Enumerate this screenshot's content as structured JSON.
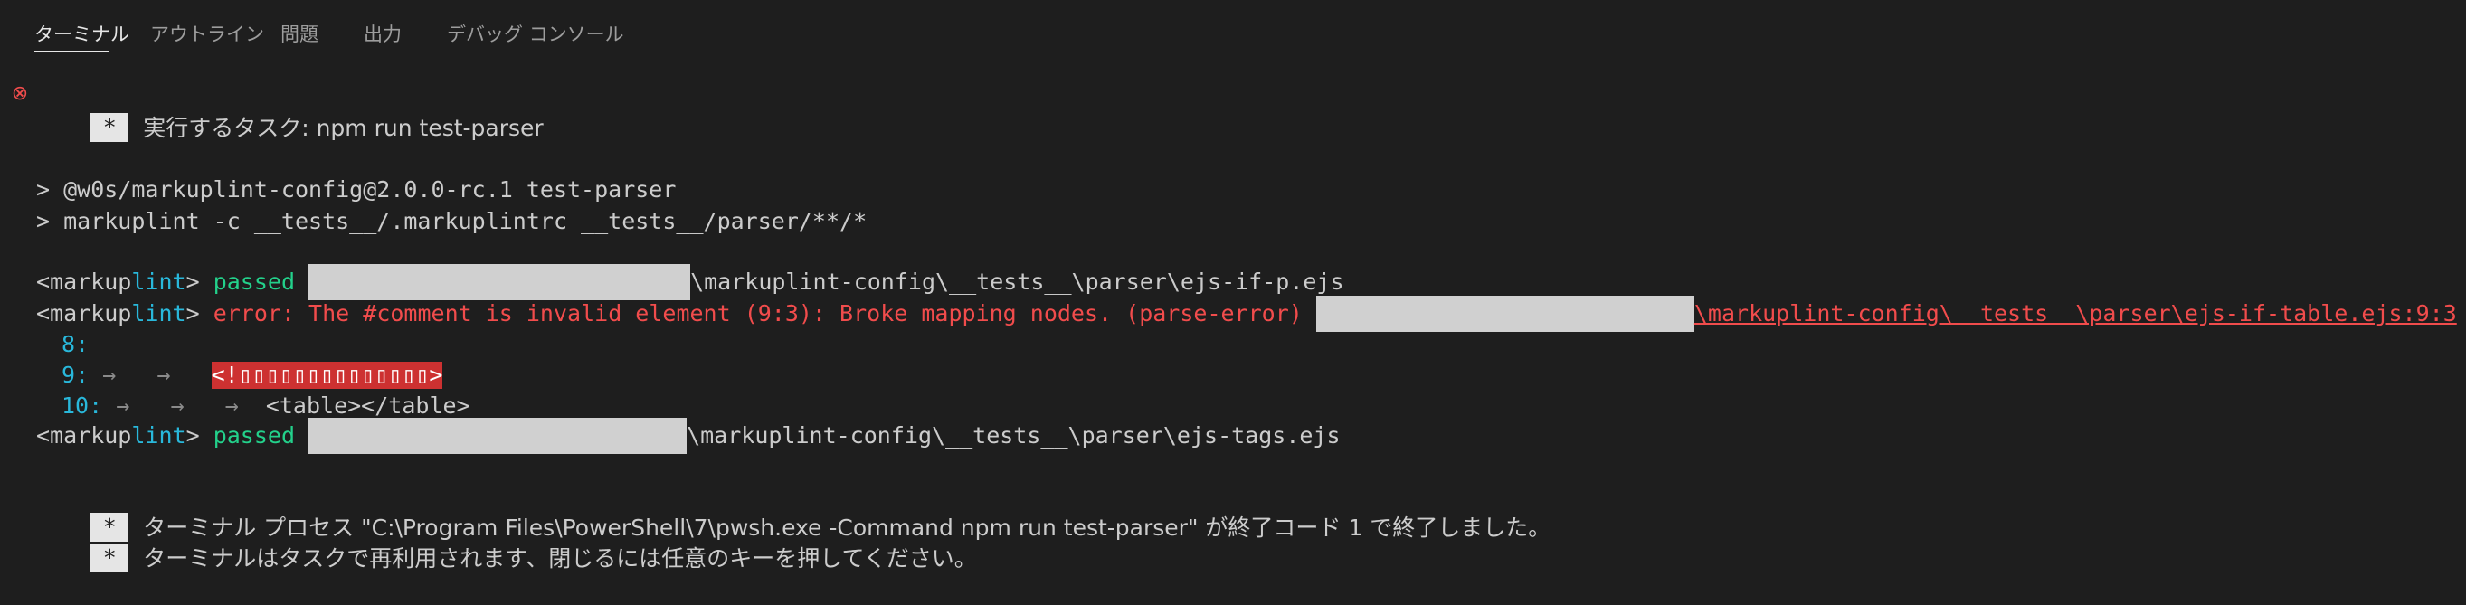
{
  "panel_tabs": [
    {
      "label": "ターミナル",
      "active": true
    },
    {
      "label": "アウトライン",
      "active": false
    },
    {
      "label": "問題",
      "active": false
    },
    {
      "label": "出力",
      "active": false
    },
    {
      "label": "デバッグ コンソール",
      "active": false
    }
  ],
  "terminal": {
    "task_star": "*",
    "task_label": "実行するタスク: npm run test-parser",
    "cmd_line_1": "> @w0s/markuplint-config@2.0.0-rc.1 test-parser",
    "cmd_line_2": "> markuplint -c __tests__/.markuplintrc __tests__/parser/**/*",
    "markup_prefix": "<markup",
    "lint_word": "lint",
    "markup_suffix": ">",
    "passed": "passed",
    "error_text": "error: The #comment is invalid element (9:3): Broke mapping nodes. (parse-error)",
    "path_1": "\\markuplint-config\\__tests__\\parser\\ejs-if-p.ejs",
    "path_2": "\\markuplint-config\\__tests__\\parser\\ejs-if-table.ejs:9:3",
    "path_3": "\\markuplint-config\\__tests__\\parser\\ejs-tags.ejs",
    "code_line_8_num": "8:",
    "code_line_9_num": "9:",
    "code_line_10_num": "10:",
    "tab_arrow": "→",
    "code_line_9_text": "<!▯▯▯▯▯▯▯▯▯▯▯▯▯▯>",
    "code_line_10_text": "<table></table>",
    "final_star_1": "*",
    "final_msg_1": "ターミナル プロセス \"C:\\Program Files\\PowerShell\\7\\pwsh.exe -Command npm run test-parser\" が終了コード 1 で終了しました。",
    "final_star_2": "*",
    "final_msg_2": "ターミナルはタスクで再利用されます、閉じるには任意のキーを押してください。"
  },
  "colors": {
    "background": "#1e1e1e",
    "cyan": "#29b8db",
    "green": "#23d18b",
    "red": "#f14c4c",
    "highlight": "#cd3131"
  }
}
